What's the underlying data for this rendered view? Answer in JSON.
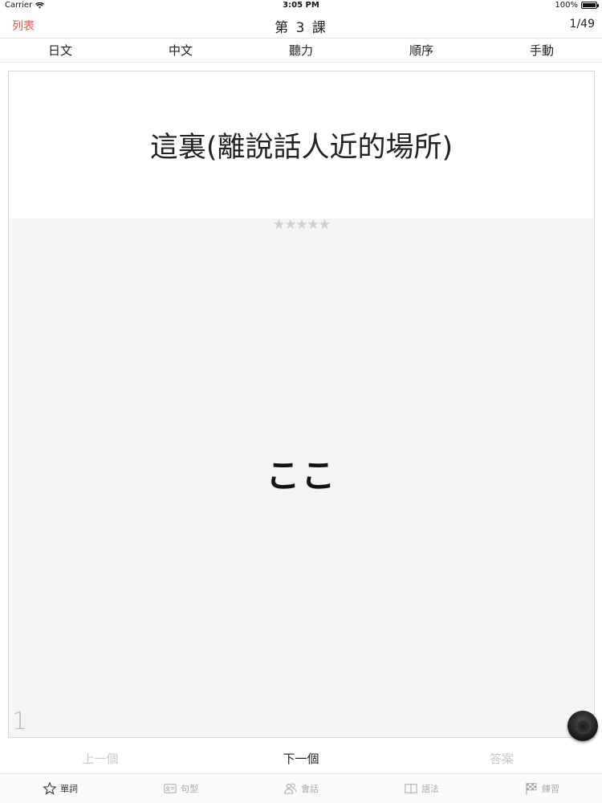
{
  "status": {
    "carrier": "Carrier",
    "time": "3:05 PM",
    "battery": "100%",
    "battery_level": 1.0
  },
  "nav": {
    "back_label": "列表",
    "title": "第 3 課",
    "counter": "1/49"
  },
  "modes": [
    {
      "label": "日文"
    },
    {
      "label": "中文"
    },
    {
      "label": "聽力"
    },
    {
      "label": "順序"
    },
    {
      "label": "手動"
    }
  ],
  "card": {
    "question": "這裏(離說話人近的場所)",
    "stars": "★★★★★",
    "rating": 0,
    "answer": "ここ",
    "index": "1"
  },
  "controls": {
    "prev_label": "上一個",
    "next_label": "下一個",
    "answer_label": "答案"
  },
  "tabs": [
    {
      "label": "單詞",
      "icon": "star-icon",
      "active": true
    },
    {
      "label": "句型",
      "icon": "card-icon",
      "active": false
    },
    {
      "label": "會話",
      "icon": "people-icon",
      "active": false
    },
    {
      "label": "語法",
      "icon": "book-icon",
      "active": false
    },
    {
      "label": "練習",
      "icon": "flag-icon",
      "active": false
    }
  ],
  "colors": {
    "accent": "#e05a4a",
    "card_bg": "#f4f4f6",
    "star_inactive": "#d0d0d0"
  }
}
